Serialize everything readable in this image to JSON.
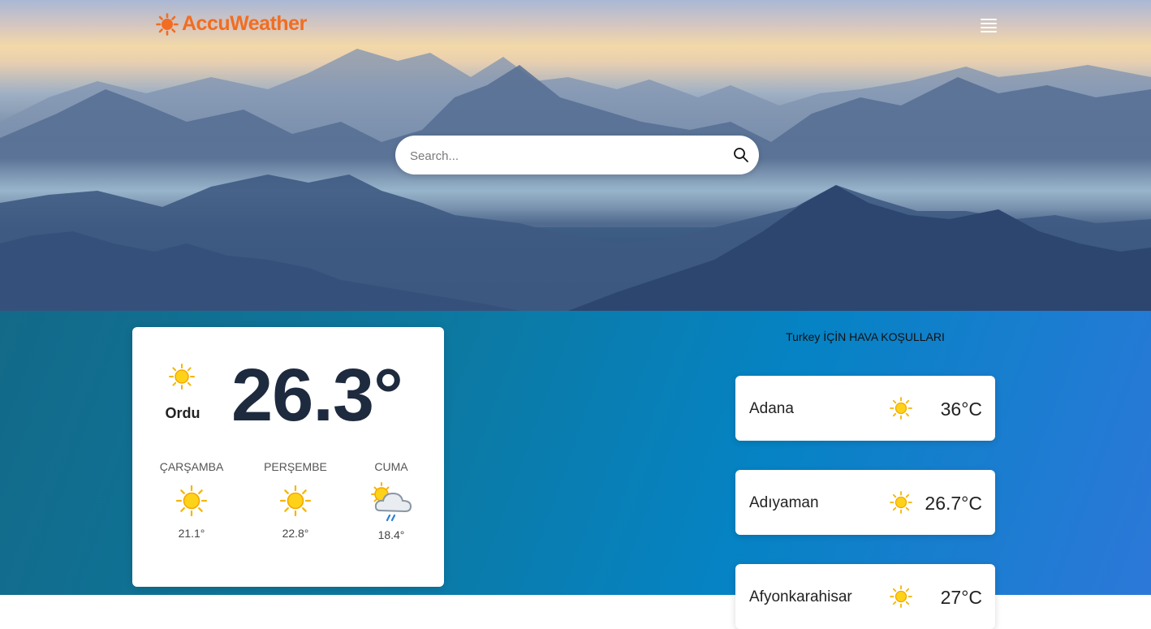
{
  "brand": {
    "name": "AccuWeather",
    "color": "#f26d21"
  },
  "header": {
    "menu_icon": "hamburger-menu-icon"
  },
  "search": {
    "placeholder": "Search...",
    "icon": "search-icon"
  },
  "current": {
    "city": "Ordu",
    "temperature": "26.3°",
    "icon": "sunny-icon"
  },
  "forecast": [
    {
      "day": "ÇARŞAMBA",
      "temp": "21.1°",
      "icon": "sunny-icon"
    },
    {
      "day": "PERŞEMBE",
      "temp": "22.8°",
      "icon": "sunny-icon"
    },
    {
      "day": "CUMA",
      "temp": "18.4°",
      "icon": "partly-cloudy-rain-icon"
    }
  ],
  "conditions": {
    "title": "Turkey İÇİN HAVA KOŞULLARI",
    "cities": [
      {
        "name": "Adana",
        "temp": "36°C",
        "icon": "sunny-icon"
      },
      {
        "name": "Adıyaman",
        "temp": "26.7°C",
        "icon": "sunny-icon"
      },
      {
        "name": "Afyonkarahisar",
        "temp": "27°C",
        "icon": "sunny-icon"
      }
    ]
  }
}
